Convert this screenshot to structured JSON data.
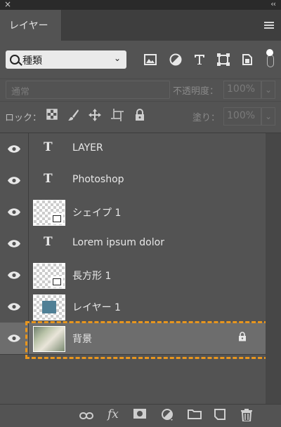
{
  "panel": {
    "tab_label": "レイヤー",
    "panel_menu": "panel-menu-icon",
    "top_close": "×",
    "top_collapse": "‹‹"
  },
  "filter": {
    "kind_label": "種類",
    "icons": [
      "image-icon",
      "adjustment-icon",
      "text-icon",
      "shape-icon",
      "smart-object-icon"
    ]
  },
  "blend": {
    "mode": "通常",
    "opacity_label": "不透明度：",
    "opacity_value": "100%"
  },
  "lock": {
    "label": "ロック：",
    "icons": [
      "lock-transparency-icon",
      "lock-paint-icon",
      "lock-move-icon",
      "lock-artboard-icon",
      "lock-all-icon"
    ],
    "fill_label": "塗り：",
    "fill_value": "100%"
  },
  "layers": [
    {
      "name": "LAYER",
      "kind": "text",
      "visible": true
    },
    {
      "name": "Photoshop",
      "kind": "text",
      "visible": true
    },
    {
      "name": "シェイプ 1",
      "kind": "shape",
      "visible": true
    },
    {
      "name": "Lorem ipsum dolor",
      "kind": "text",
      "visible": true
    },
    {
      "name": "長方形 1",
      "kind": "shape",
      "visible": true
    },
    {
      "name": "レイヤー 1",
      "kind": "pixel",
      "visible": true
    },
    {
      "name": "背景",
      "kind": "background",
      "visible": true,
      "locked": true,
      "selected": true
    }
  ],
  "bottom_toolbar": [
    "link-icon",
    "fx-icon",
    "mask-icon",
    "adjustment-layer-icon",
    "group-folder-icon",
    "new-layer-icon",
    "trash-icon"
  ],
  "colors": {
    "panel_bg": "#535353",
    "highlight": "#e8961e",
    "layer_blue": "#4f7f95"
  }
}
